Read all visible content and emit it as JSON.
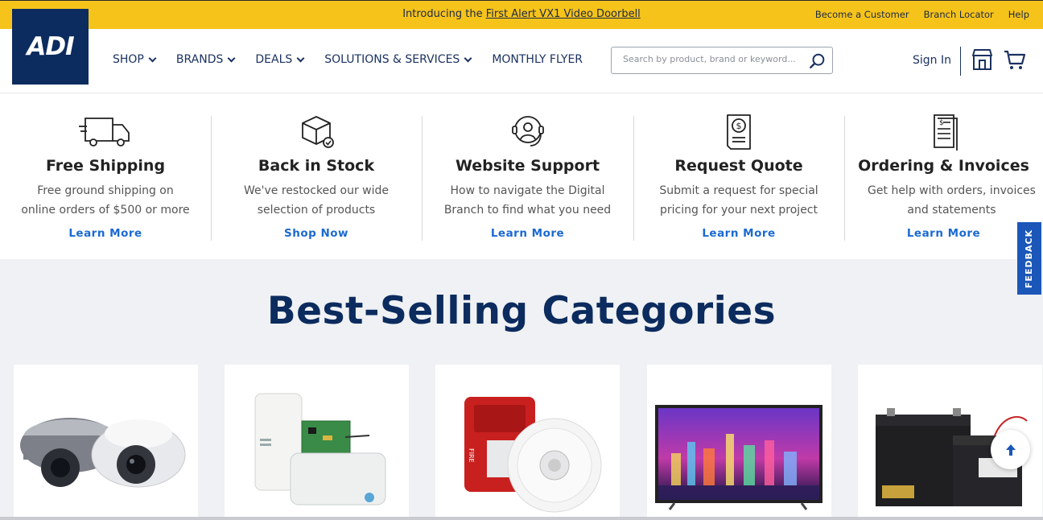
{
  "topbar": {
    "promo_prefix": "Introducing the ",
    "promo_link": "First Alert VX1 Video Doorbell",
    "links": [
      "Become a Customer",
      "Branch Locator",
      "Help"
    ]
  },
  "header": {
    "logo_text": "ADI",
    "nav": [
      {
        "label": "SHOP",
        "has_dropdown": true
      },
      {
        "label": "BRANDS",
        "has_dropdown": true
      },
      {
        "label": "DEALS",
        "has_dropdown": true
      },
      {
        "label": "SOLUTIONS & SERVICES",
        "has_dropdown": true
      },
      {
        "label": "MONTHLY FLYER",
        "has_dropdown": false
      }
    ],
    "search_placeholder": "Search by product, brand or keyword...",
    "sign_in": "Sign In",
    "icons": [
      "search-icon",
      "store-icon",
      "cart-icon"
    ]
  },
  "features": [
    {
      "icon": "truck-icon",
      "title": "Free Shipping",
      "desc": "Free ground shipping on online orders of $500 or more",
      "link": "Learn More"
    },
    {
      "icon": "box-check-icon",
      "title": "Back in Stock",
      "desc": "We've restocked our wide selection of products",
      "link": "Shop Now"
    },
    {
      "icon": "headset-icon",
      "title": "Website Support",
      "desc": "How to navigate the Digital Branch to find what you need",
      "link": "Learn More"
    },
    {
      "icon": "quote-document-icon",
      "title": "Request Quote",
      "desc": "Submit a request for special pricing for your next project",
      "link": "Learn More"
    },
    {
      "icon": "invoice-icon",
      "title": "Ordering & Invoices",
      "desc": "Get help with orders, invoices and statements",
      "link": "Learn More"
    }
  ],
  "best_selling": {
    "title": "Best-Selling Categories",
    "cards": [
      {
        "image": "security-cameras-image"
      },
      {
        "image": "wireless-sensors-image"
      },
      {
        "image": "fire-alarm-devices-image"
      },
      {
        "image": "television-display-image"
      },
      {
        "image": "batteries-image"
      }
    ]
  },
  "feedback_label": "FEEDBACK",
  "colors": {
    "accent_yellow": "#f6c31b",
    "brand_navy": "#0c2b5e",
    "link_blue": "#1b6ad1",
    "feedback_blue": "#1b57b8"
  }
}
